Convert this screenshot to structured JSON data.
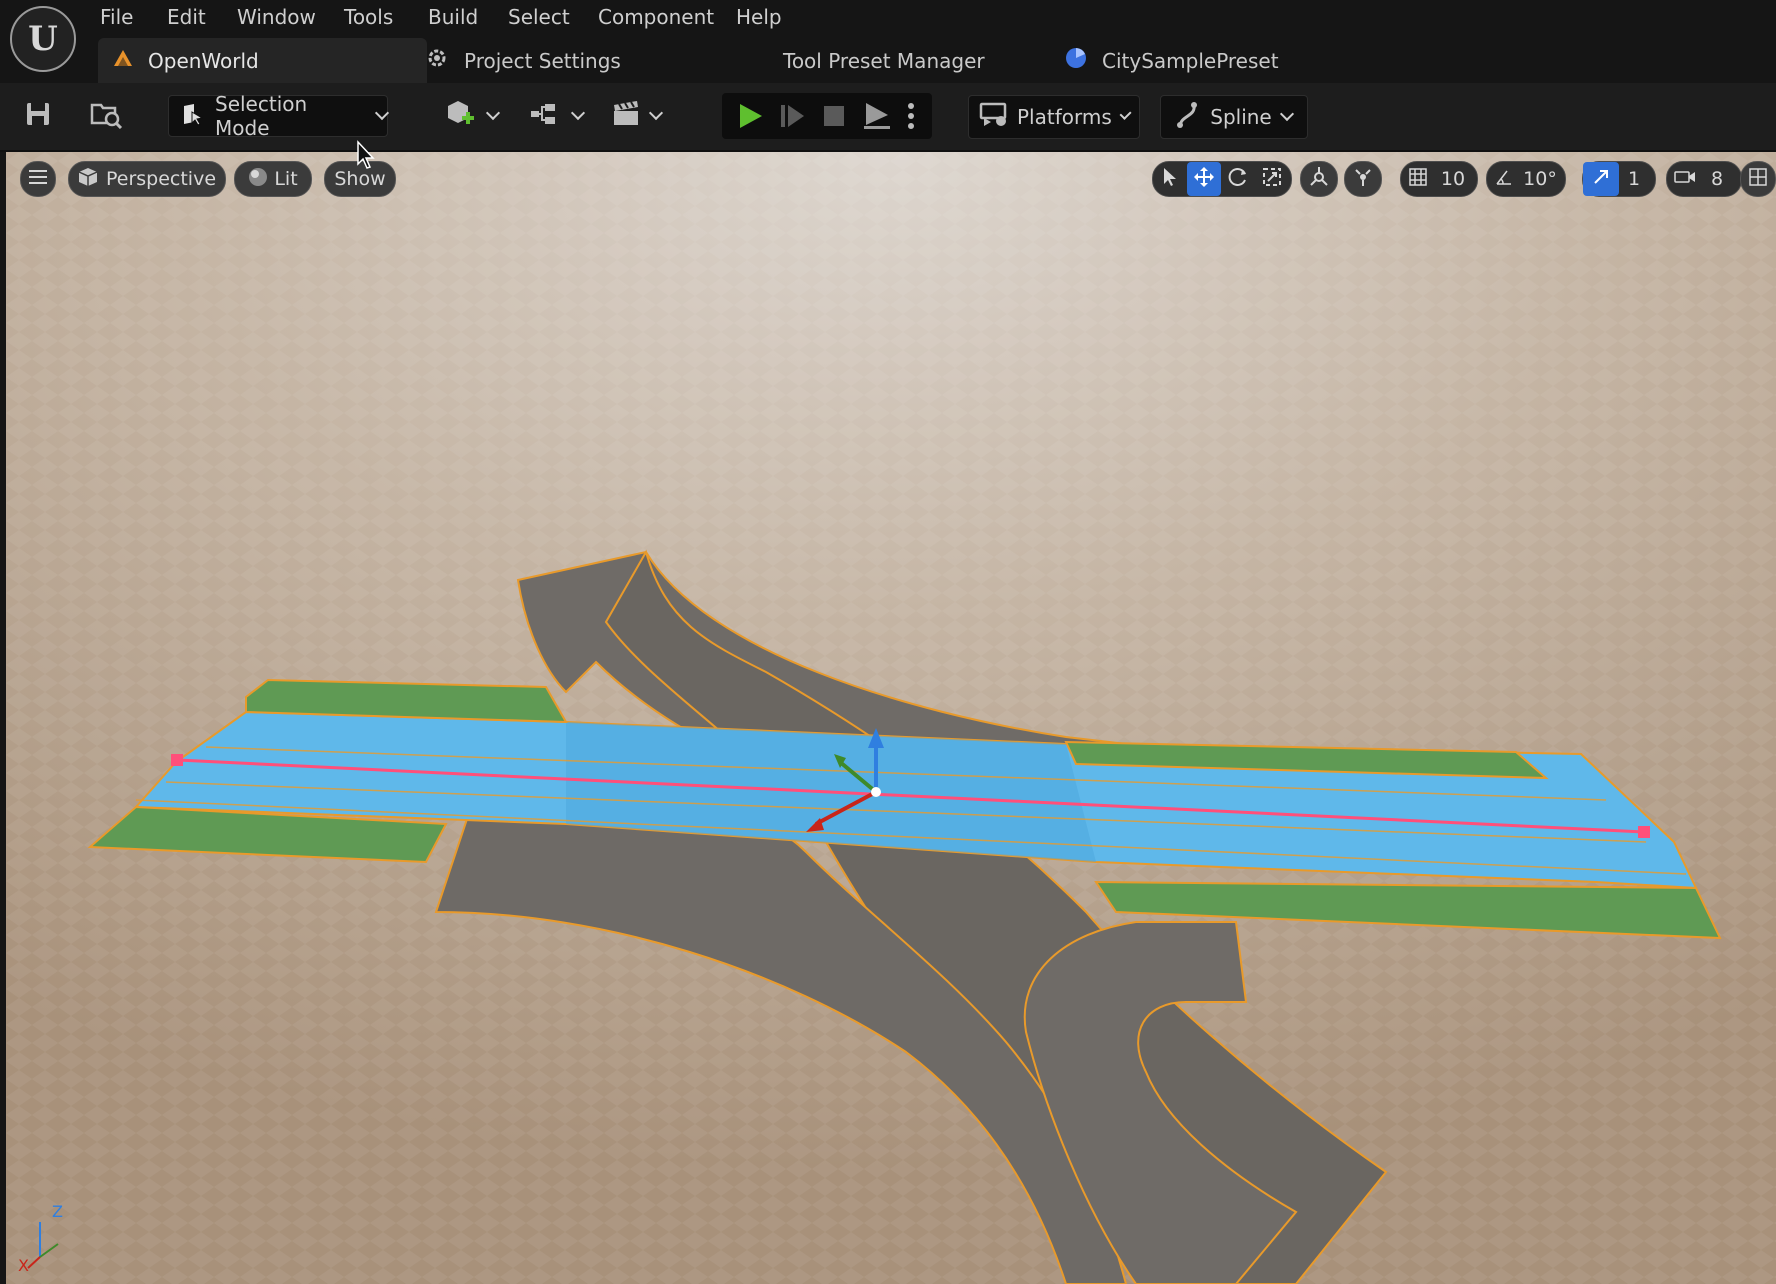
{
  "menu": [
    "File",
    "Edit",
    "Window",
    "Tools",
    "Build",
    "Select",
    "Component",
    "Help"
  ],
  "tabs": [
    {
      "label": "OpenWorld",
      "icon": "level-icon",
      "active": true
    },
    {
      "label": "Project Settings",
      "icon": "settings-icon",
      "active": false
    },
    {
      "label": "Tool Preset Manager",
      "icon": "",
      "active": false
    },
    {
      "label": "CitySamplePreset",
      "icon": "preset-icon",
      "active": false
    }
  ],
  "toolbar": {
    "selection_mode": "Selection Mode",
    "platforms": "Platforms",
    "spline": "Spline"
  },
  "viewport": {
    "perspective": "Perspective",
    "lit": "Lit",
    "show": "Show",
    "grid_snap": "10",
    "rotation_snap": "10°",
    "scale_snap": "1",
    "camera_speed": "8"
  },
  "axis": {
    "z": "Z",
    "x": "X"
  },
  "colors": {
    "accent": "#2f6fd6",
    "play": "#5fbf2f",
    "spline": "#ff4f7a",
    "lane_blue": "#5fb8ea",
    "grass": "#5f9a54",
    "asphalt": "#6e6a66",
    "ground": "#b9a58f",
    "edge_orange": "#e89a2b"
  }
}
